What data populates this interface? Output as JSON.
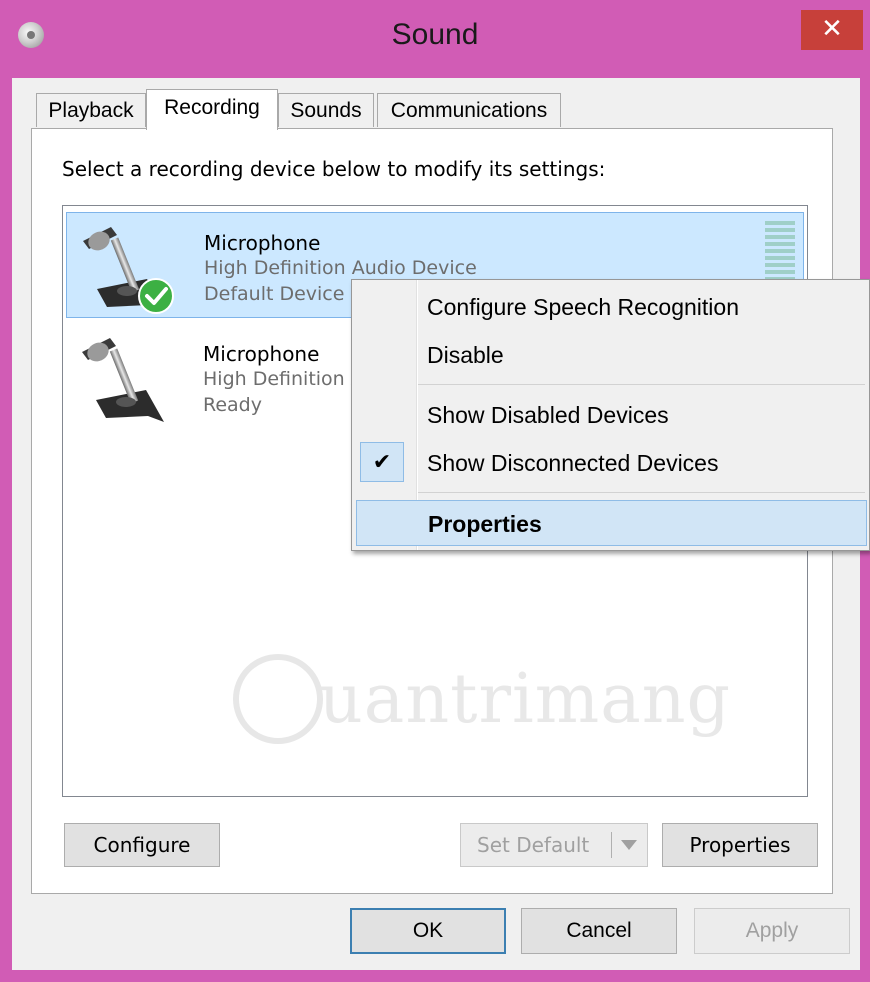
{
  "window": {
    "title": "Sound",
    "close_glyph": "✕",
    "app_icon": "speaker-icon"
  },
  "tabs": [
    {
      "label": "Playback",
      "active": false
    },
    {
      "label": "Recording",
      "active": true
    },
    {
      "label": "Sounds",
      "active": false
    },
    {
      "label": "Communications",
      "active": false
    }
  ],
  "panel": {
    "instructions": "Select a recording device below to modify its settings:"
  },
  "devices": [
    {
      "name": "Microphone",
      "description": "High Definition Audio Device",
      "status": "Default Device",
      "selected": true,
      "is_default": true,
      "icon": "microphone-icon"
    },
    {
      "name": "Microphone",
      "description": "High Definition Audio Device",
      "status": "Ready",
      "selected": false,
      "is_default": false,
      "icon": "microphone-icon"
    }
  ],
  "watermark": {
    "text": "uantrimang"
  },
  "buttons": {
    "configure": "Configure",
    "set_default": "Set Default",
    "properties": "Properties"
  },
  "footer": {
    "ok": "OK",
    "cancel": "Cancel",
    "apply": "Apply"
  },
  "context_menu": {
    "items": [
      {
        "label": "Configure Speech Recognition",
        "checked": false,
        "bold": false,
        "highlighted": false
      },
      {
        "label": "Disable",
        "checked": false,
        "bold": false,
        "highlighted": false
      },
      {
        "label": "Show Disabled Devices",
        "checked": false,
        "bold": false,
        "highlighted": false
      },
      {
        "label": "Show Disconnected Devices",
        "checked": true,
        "bold": false,
        "highlighted": false
      },
      {
        "label": "Properties",
        "checked": false,
        "bold": true,
        "highlighted": true
      }
    ],
    "check_glyph": "✔"
  },
  "colors": {
    "window_frame": "#d15cb5",
    "close_button": "#c7403a",
    "selection_bg": "#cce8ff",
    "menu_highlight": "#d1e5f6",
    "default_check": "#3cb043"
  }
}
